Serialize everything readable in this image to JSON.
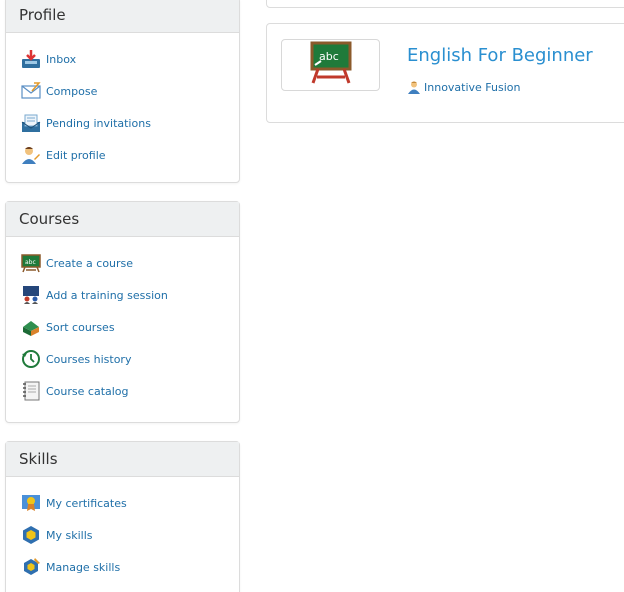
{
  "profile": {
    "title": "Profile",
    "items": [
      {
        "label": "Inbox",
        "icon": "inbox-icon"
      },
      {
        "label": "Compose",
        "icon": "envelope-icon"
      },
      {
        "label": "Pending invitations",
        "icon": "invitation-icon"
      },
      {
        "label": "Edit profile",
        "icon": "user-edit-icon"
      }
    ]
  },
  "courses": {
    "title": "Courses",
    "items": [
      {
        "label": "Create a course",
        "icon": "chalkboard-icon"
      },
      {
        "label": "Add a training session",
        "icon": "session-icon"
      },
      {
        "label": "Sort courses",
        "icon": "sort-icon"
      },
      {
        "label": "Courses history",
        "icon": "history-icon"
      },
      {
        "label": "Course catalog",
        "icon": "catalog-icon"
      }
    ]
  },
  "skills": {
    "title": "Skills",
    "items": [
      {
        "label": "My certificates",
        "icon": "certificate-icon"
      },
      {
        "label": "My skills",
        "icon": "skills-icon"
      },
      {
        "label": "Manage skills",
        "icon": "manage-skills-icon"
      }
    ]
  },
  "course_card": {
    "title": "English For Beginner",
    "teacher": "Innovative Fusion",
    "thumb_text": "abc",
    "icon": "chalkboard-icon"
  },
  "colors": {
    "link": "#1f6fa8",
    "title": "#2a8fd0",
    "panel_header_bg": "#eef0f1",
    "border": "#dcdcdc"
  }
}
